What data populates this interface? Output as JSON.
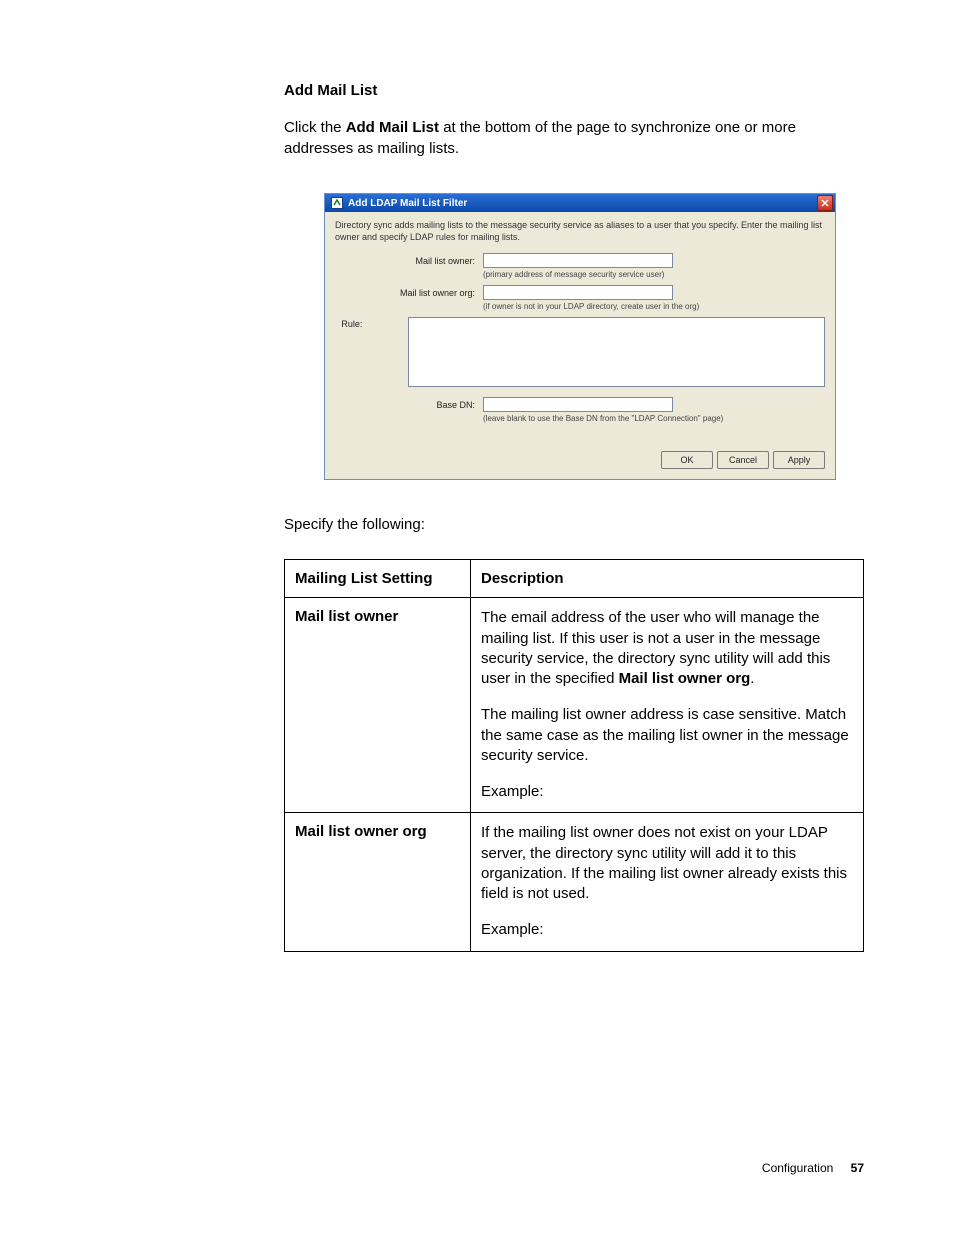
{
  "heading": "Add Mail List",
  "intro_pre": "Click the ",
  "intro_bold": "Add Mail List",
  "intro_post": " at the bottom of the page to synchronize one or more addresses as mailing lists.",
  "dialog": {
    "title": "Add LDAP Mail List Filter",
    "instr": "Directory sync adds mailing lists to the message security service as aliases to a user that you specify. Enter the mailing list owner and specify LDAP rules for mailing lists.",
    "labels": {
      "mail_list_owner": "Mail list owner:",
      "mail_list_owner_org": "Mail list owner org:",
      "rule": "Rule:",
      "base_dn": "Base DN:"
    },
    "hints": {
      "mail_list_owner": "(primary address of message security service user)",
      "mail_list_owner_org": "(if owner is not in your LDAP directory, create user in the org)",
      "base_dn": "(leave blank to use the Base DN from the \"LDAP Connection\" page)"
    },
    "values": {
      "mail_list_owner": "",
      "mail_list_owner_org": "",
      "rule": "",
      "base_dn": ""
    },
    "buttons": {
      "ok": "OK",
      "cancel": "Cancel",
      "apply": "Apply"
    }
  },
  "specify": "Specify the following:",
  "table": {
    "head": {
      "c1": "Mailing List Setting",
      "c2": "Description"
    },
    "row1": {
      "label": "Mail list owner",
      "p1a": "The email address of the user who will manage the mailing list. If this user is not a user in the message security service, the directory sync utility will add this user in the specified ",
      "p1b": "Mail list owner org",
      "p1c": ".",
      "p2": "The mailing list owner address is case sensitive. Match the same case as the mailing list owner in the message security service.",
      "p3": "Example:"
    },
    "row2": {
      "label": "Mail list owner org",
      "p1": "If the mailing list owner does not exist on your LDAP server, the directory sync utility will add it to this organization. If the mailing list owner already exists this field is not used.",
      "p2": "Example:"
    }
  },
  "footer": {
    "section": "Configuration",
    "page": "57"
  }
}
